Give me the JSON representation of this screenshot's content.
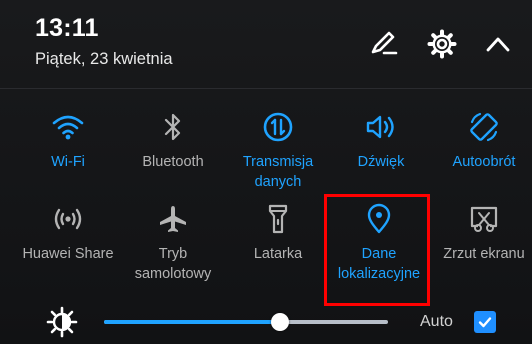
{
  "header": {
    "time": "13:11",
    "date": "Piątek, 23 kwietnia",
    "edit_icon": "pencil-icon",
    "settings_icon": "gear-icon",
    "collapse_icon": "chevron-up-icon"
  },
  "colors": {
    "active": "#1fa3ff",
    "inactive": "#b4b4b4",
    "background": "#151618",
    "highlight": "#ff0000"
  },
  "tiles": [
    {
      "label": "Wi-Fi",
      "icon": "wifi-icon",
      "active": true
    },
    {
      "label": "Bluetooth",
      "icon": "bluetooth-icon",
      "active": false
    },
    {
      "label": "Transmisja danych",
      "icon": "mobile-data-icon",
      "active": true
    },
    {
      "label": "Dźwięk",
      "icon": "sound-icon",
      "active": true
    },
    {
      "label": "Autoobrót",
      "icon": "auto-rotate-icon",
      "active": true
    },
    {
      "label": "Huawei Share",
      "icon": "huawei-share-icon",
      "active": false
    },
    {
      "label": "Tryb samolotowy",
      "icon": "airplane-icon",
      "active": false
    },
    {
      "label": "Latarka",
      "icon": "flashlight-icon",
      "active": false
    },
    {
      "label": "Dane lokalizacyjne",
      "icon": "location-icon",
      "active": true,
      "highlighted": true
    },
    {
      "label": "Zrzut ekranu",
      "icon": "screenshot-icon",
      "active": false
    }
  ],
  "brightness": {
    "icon": "brightness-icon",
    "level": 0.62,
    "auto_label": "Auto",
    "auto_checked": true
  }
}
